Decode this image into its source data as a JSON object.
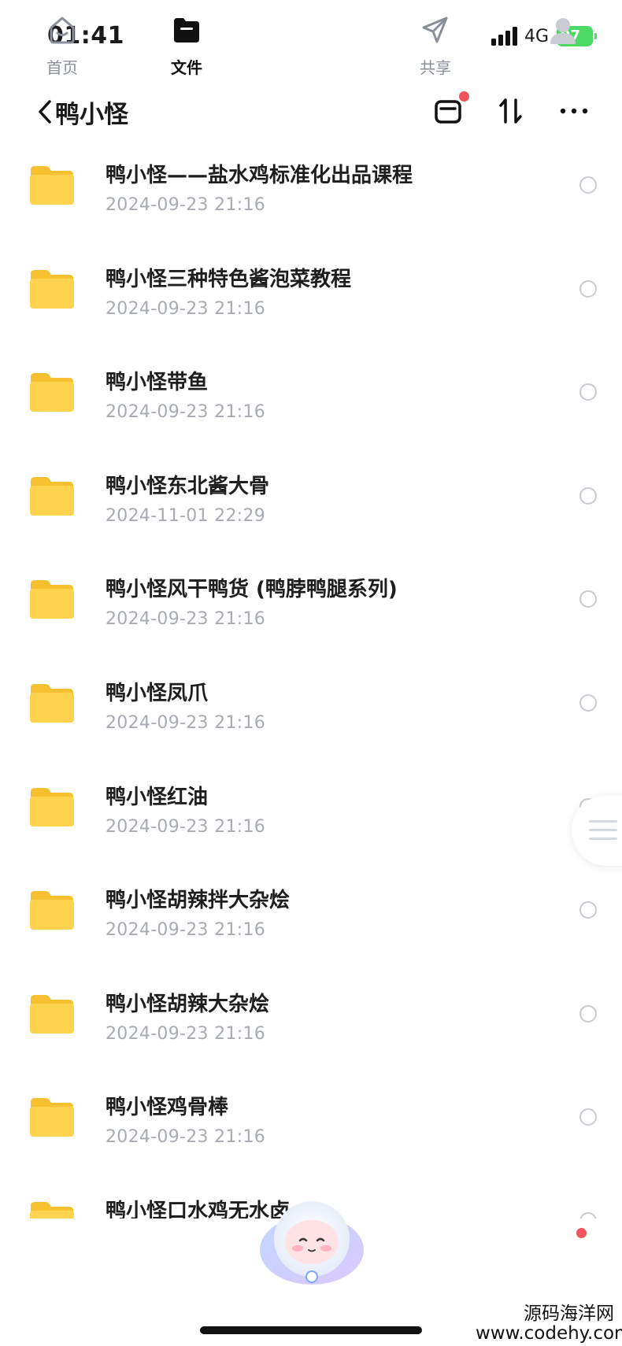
{
  "status_bar": {
    "time": "01:41",
    "network": "4G",
    "battery": "97"
  },
  "nav": {
    "title": "鸭小怪"
  },
  "colors": {
    "folder": "#ffd34d",
    "accent_red": "#f2545b",
    "date_gray": "#a7abb2"
  },
  "files": [
    {
      "name": "鸭小怪——盐水鸡标准化出品课程",
      "date": "2024-09-23 21:16"
    },
    {
      "name": "鸭小怪三种特色酱泡菜教程",
      "date": "2024-09-23 21:16"
    },
    {
      "name": "鸭小怪带鱼",
      "date": "2024-09-23 21:16"
    },
    {
      "name": "鸭小怪东北酱大骨",
      "date": "2024-11-01 22:29"
    },
    {
      "name": "鸭小怪风干鸭货 (鸭脖鸭腿系列)",
      "date": "2024-09-23 21:16"
    },
    {
      "name": "鸭小怪凤爪",
      "date": "2024-09-23 21:16"
    },
    {
      "name": "鸭小怪红油",
      "date": "2024-09-23 21:16"
    },
    {
      "name": "鸭小怪胡辣拌大杂烩",
      "date": "2024-09-23 21:16"
    },
    {
      "name": "鸭小怪胡辣大杂烩",
      "date": "2024-09-23 21:16"
    },
    {
      "name": "鸭小怪鸡骨棒",
      "date": "2024-09-23 21:16"
    },
    {
      "name": "鸭小怪口水鸡无水卤",
      "date": ""
    }
  ],
  "tabs": [
    {
      "label": "首页",
      "icon": "home-icon"
    },
    {
      "label": "文件",
      "icon": "folder-icon"
    },
    {
      "label": "共享",
      "icon": "send-icon"
    },
    {
      "label": "",
      "icon": "avatar-icon"
    }
  ],
  "watermark": {
    "line1": "源码海洋网",
    "line2": "www.codehy.com"
  }
}
